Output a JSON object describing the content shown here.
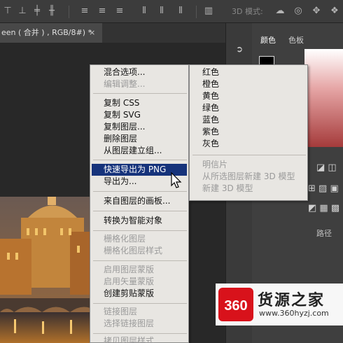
{
  "options_bar": {
    "mode_3d_label": "3D 模式:",
    "icons": [
      "align-top-icon",
      "align-vcenter-icon",
      "align-bottom-icon",
      "align-left-icon",
      "align-hcenter-icon",
      "align-right-icon",
      "distribute-top-icon",
      "distribute-vcenter-icon",
      "distribute-bottom-icon",
      "distribute-left-icon",
      "distribute-hcenter-icon",
      "distribute-right-icon",
      "auto-align-icon",
      "rotate-3d-icon",
      "roll-3d-icon",
      "drag-3d-icon"
    ]
  },
  "document_tab": {
    "title": "een ( 合并 ) , RGB/8#) *",
    "close": "×"
  },
  "panels": {
    "color_tab": "颜色",
    "swatches_tab": "色板",
    "paths_tab": "路径"
  },
  "context_menu": {
    "items": [
      {
        "label": "混合选项...",
        "enabled": true
      },
      {
        "label": "编辑调整...",
        "enabled": false
      },
      {
        "label": "复制 CSS",
        "enabled": true
      },
      {
        "label": "复制 SVG",
        "enabled": true
      },
      {
        "label": "复制图层...",
        "enabled": true
      },
      {
        "label": "删除图层",
        "enabled": true
      },
      {
        "label": "从图层建立组...",
        "enabled": true
      },
      {
        "label": "快速导出为 PNG",
        "enabled": true,
        "highlighted": true
      },
      {
        "label": "导出为...",
        "enabled": true
      },
      {
        "label": "来自图层的画板...",
        "enabled": true
      },
      {
        "label": "转换为智能对象",
        "enabled": true
      },
      {
        "label": "栅格化图层",
        "enabled": false
      },
      {
        "label": "栅格化图层样式",
        "enabled": false
      },
      {
        "label": "启用图层蒙版",
        "enabled": false
      },
      {
        "label": "启用矢量蒙版",
        "enabled": false
      },
      {
        "label": "创建剪贴蒙版",
        "enabled": true
      },
      {
        "label": "链接图层",
        "enabled": false
      },
      {
        "label": "选择链接图层",
        "enabled": false
      },
      {
        "label": "拷贝图层样式",
        "enabled": false
      }
    ]
  },
  "color_submenu": {
    "items": [
      {
        "label": "红色",
        "enabled": true
      },
      {
        "label": "橙色",
        "enabled": true
      },
      {
        "label": "黄色",
        "enabled": true
      },
      {
        "label": "绿色",
        "enabled": true
      },
      {
        "label": "蓝色",
        "enabled": true
      },
      {
        "label": "紫色",
        "enabled": true
      },
      {
        "label": "灰色",
        "enabled": true
      },
      {
        "label": "明信片",
        "enabled": false
      },
      {
        "label": "从所选图层新建 3D 模型",
        "enabled": false
      },
      {
        "label": "新建 3D 模型",
        "enabled": false
      }
    ]
  },
  "watermark": {
    "logo_text": "360",
    "title": "货源之家",
    "url": "www.360hyzj.com"
  },
  "colors": {
    "highlight": "#16337b",
    "menu_bg": "#e8e6e2",
    "logo_red": "#d8121b"
  }
}
